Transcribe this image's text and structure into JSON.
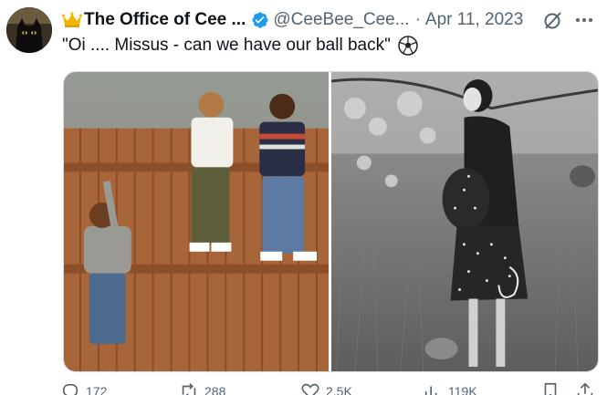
{
  "tweet": {
    "display_name": "The Office of Cee ...",
    "handle": "@CeeBee_Cee...",
    "separator": "·",
    "date": "Apr 11, 2023",
    "text": "\"Oi .... Missus - can we have our ball back\"",
    "emoji": "soccer-ball-icon",
    "verified": true
  },
  "media": {
    "left_image": "photo-kids-climbing-fence",
    "right_image": "photo-pregnant-woman-garden-bw"
  },
  "actions": {
    "replies": "172",
    "retweets": "288",
    "likes": "2.5K",
    "views": "119K"
  },
  "colors": {
    "text": "#0f1419",
    "secondary": "#536471",
    "verified": "#1d9bf0",
    "border": "#cfd9de"
  }
}
